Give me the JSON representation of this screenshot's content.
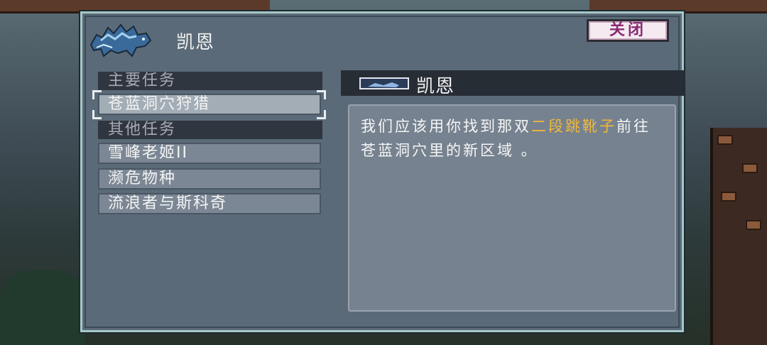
{
  "dialog": {
    "npc_name": "凯恩",
    "close_label": "关闭"
  },
  "quests": {
    "main_header": "主要任务",
    "main": [
      {
        "label": "苍蓝洞穴狩猎",
        "selected": true
      }
    ],
    "other_header": "其他任务",
    "other": [
      {
        "label": "雪峰老姬II"
      },
      {
        "label": "濒危物种"
      },
      {
        "label": "流浪者与斯科奇"
      }
    ]
  },
  "detail": {
    "title": "凯恩",
    "text_part1": "我们应该用你找到那双",
    "text_highlight": "二段跳靴子",
    "text_part2": "前往苍蓝洞穴里的新区域 。",
    "highlight_color": "#f2b83a"
  }
}
